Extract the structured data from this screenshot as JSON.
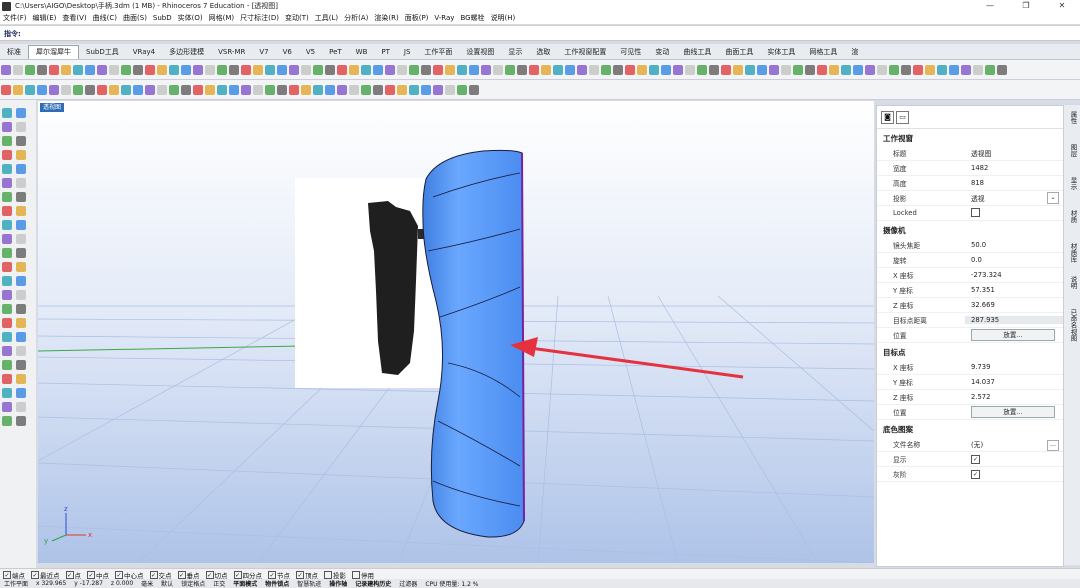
{
  "window": {
    "title": "C:\\Users\\AIGO\\Desktop\\手柄.3dm (1 MB) - Rhinoceros 7 Education - [透视图]"
  },
  "menu": [
    "文件(F)",
    "编辑(E)",
    "查看(V)",
    "曲线(C)",
    "曲面(S)",
    "SubD",
    "实体(O)",
    "网格(M)",
    "尺寸标注(D)",
    "变动(T)",
    "工具(L)",
    "分析(A)",
    "渲染(R)",
    "面板(P)",
    "V-Ray",
    "BG螺栓",
    "说明(H)"
  ],
  "command": {
    "label": "指令:"
  },
  "tabs": [
    "标准",
    "犀尔溜犀牛",
    "SubD工具",
    "VRay4",
    "多边形建模",
    "VSR-MR",
    "V7",
    "V6",
    "V5",
    "PeT",
    "WB",
    "PT",
    "JS",
    "工作平面",
    "设置视图",
    "显示",
    "选取",
    "工作视窗配置",
    "可见性",
    "变动",
    "曲线工具",
    "曲面工具",
    "实体工具",
    "网格工具",
    "渲"
  ],
  "viewport": {
    "label": "透视图",
    "axis_labels": {
      "x": "x",
      "y": "y",
      "z": "z"
    }
  },
  "panel": {
    "section_viewport": "工作视窗",
    "title_k": "标题",
    "title_v": "透视图",
    "width_k": "宽度",
    "width_v": "1482",
    "height_k": "高度",
    "height_v": "818",
    "proj_k": "投影",
    "proj_v": "透视",
    "locked_k": "Locked",
    "section_camera": "摄像机",
    "lens_k": "镜头焦距",
    "lens_v": "50.0",
    "rot_k": "旋转",
    "rot_v": "0.0",
    "cx_k": "X 座标",
    "cx_v": "-273.324",
    "cy_k": "Y 座标",
    "cy_v": "57.351",
    "cz_k": "Z 座标",
    "cz_v": "32.669",
    "dist_k": "目标点距离",
    "dist_v": "287.935",
    "pos_k": "位置",
    "place_btn": "放置...",
    "section_target": "目标点",
    "tx_k": "X 座标",
    "tx_v": "9.739",
    "ty_k": "Y 座标",
    "ty_v": "14.037",
    "tz_k": "Z 座标",
    "tz_v": "2.572",
    "tpos_k": "位置",
    "section_bg": "底色图案",
    "file_k": "文件名称",
    "file_v": "(无)",
    "show_k": "显示",
    "gray_k": "灰阶"
  },
  "right_tabs": [
    "属性",
    "图层",
    "显示",
    "材质",
    "材质库",
    "说明",
    "已命名视图"
  ],
  "status": {
    "osnaps": [
      "端点",
      "最近点",
      "点",
      "中点",
      "中心点",
      "交点",
      "垂点",
      "切点",
      "四分点",
      "节点",
      "顶点",
      "投影",
      "停用"
    ],
    "plane": "工作平面",
    "x": "x 329.965",
    "y": "y -17.287",
    "z": "z 0.000",
    "unit": "毫米",
    "layer": "默认",
    "lock": "锁定格点",
    "ortho": "正交",
    "planar": "平面模式",
    "osnap": "物件锁点",
    "smart": "智慧轨迹",
    "gumball": "操作轴",
    "history": "记录建构历史",
    "filter": "过滤器",
    "cpu": "CPU 使用量: 1.2 %"
  },
  "colors": {
    "accent": "#2e6db4",
    "model": "#4f93f0",
    "arrow": "#e5323e",
    "grid_bg": "#c4d3ec"
  }
}
